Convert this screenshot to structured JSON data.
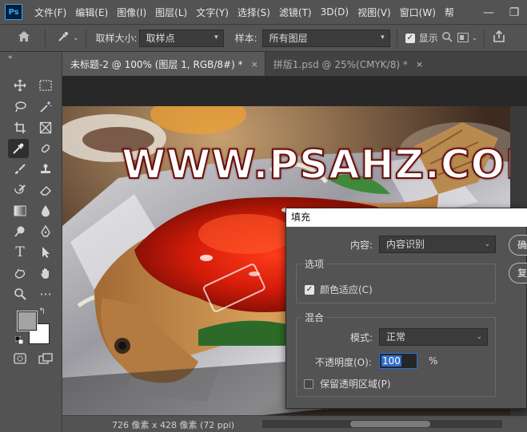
{
  "app": {
    "logo": "Ps"
  },
  "menu": [
    "文件(F)",
    "编辑(E)",
    "图像(I)",
    "图层(L)",
    "文字(Y)",
    "选择(S)",
    "滤镜(T)",
    "3D(D)",
    "视图(V)",
    "窗口(W)",
    "帮"
  ],
  "window_controls": {
    "minimize": "—",
    "restore": "❐"
  },
  "options": {
    "sample_size_label": "取样大小:",
    "sample_size_value": "取样点",
    "sample_label": "样本:",
    "sample_value": "所有图层",
    "show_label": "显示"
  },
  "tabs": [
    {
      "label": "未标题-2 @ 100% (图层 1, RGB/8#) *",
      "close": "×"
    },
    {
      "label": "拼版1.psd @ 25%(CMYK/8) *",
      "close": "×"
    }
  ],
  "canvas": {
    "watermark": "WWW.PSAHZ.COM"
  },
  "status": {
    "dimensions": "726 像素 x 428 像素 (72 ppi)"
  },
  "colors": {
    "foreground": "#a3a3a3",
    "background": "#ffffff",
    "accent": "#2f6fd0"
  },
  "dialog": {
    "title": "填充",
    "content_label": "内容:",
    "content_value": "内容识别",
    "ok_label": "确",
    "cancel_label": "复",
    "options_group": "选项",
    "color_adapt_label": "颜色适应(C)",
    "color_adapt_checked": true,
    "blend_group": "混合",
    "mode_label": "模式:",
    "mode_value": "正常",
    "opacity_label": "不透明度(O):",
    "opacity_value": "100",
    "opacity_unit": "%",
    "preserve_label": "保留透明区域(P)",
    "preserve_checked": false
  }
}
